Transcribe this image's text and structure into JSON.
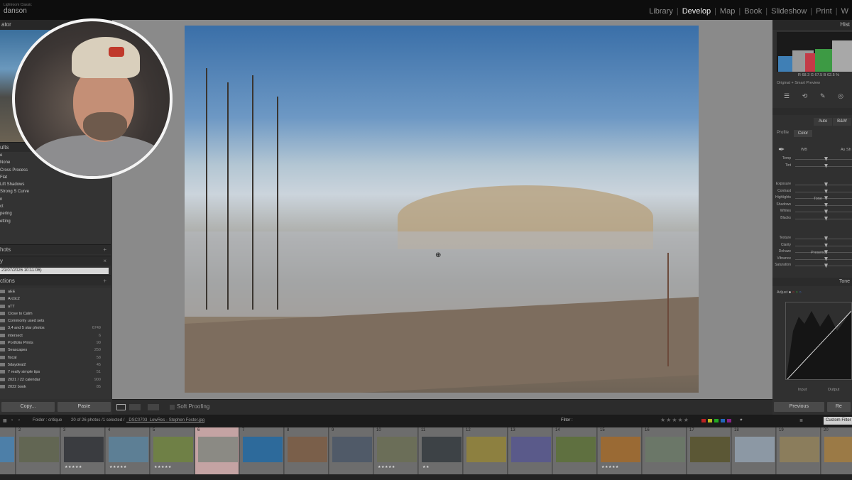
{
  "app": {
    "name": "Lightroom Classic",
    "user": "danson"
  },
  "modules": [
    "Library",
    "Develop",
    "Map",
    "Book",
    "Slideshow",
    "Print",
    "W"
  ],
  "active_module": "Develop",
  "left_panel": {
    "navigator_label": "ator",
    "presets_header": "ults",
    "presets": [
      "e",
      "None",
      "Cross Process",
      "Flat",
      "Lift Shadows",
      "Strong S Curve",
      "n",
      "ct",
      "pering",
      "etting"
    ],
    "snapshots_label": "hots",
    "history_label": "y",
    "history_entry": "21/07/2026 10:11:06)",
    "collections_label": "ctions",
    "collections": [
      {
        "name": "aEE",
        "count": ""
      },
      {
        "name": "Arctic2",
        "count": ""
      },
      {
        "name": "aTT",
        "count": ""
      },
      {
        "name": "Close to Calm",
        "count": ""
      },
      {
        "name": "Commonly used sets",
        "count": ""
      },
      {
        "name": "3,4 and 5 star photos",
        "count": "6749"
      },
      {
        "name": "intersect",
        "count": "6"
      },
      {
        "name": "Portfolio Prints",
        "count": "90"
      },
      {
        "name": "Seascapes",
        "count": "250"
      },
      {
        "name": "fiscal",
        "count": "58"
      },
      {
        "name": "5daydeal2",
        "count": "45"
      },
      {
        "name": "7 really simple tips",
        "count": "51"
      },
      {
        "name": "2021 / 22 calendar",
        "count": "900"
      },
      {
        "name": "2022 book",
        "count": "85"
      }
    ],
    "copy_button": "Copy...",
    "paste_button": "Paste"
  },
  "toolbar": {
    "soft_proofing_label": "Soft Proofing"
  },
  "right_panel": {
    "histogram_label": "Hist",
    "rgb_readout": "R  68.3  G  67.5  B  62.5 %",
    "preview_note": "Original + Smart Preview",
    "treatment": [
      "Auto",
      "B&W"
    ],
    "profile_label": "Profile",
    "profile_value": "Color",
    "wb_label": "WB",
    "wb_value": "As Sh",
    "sliders_wb": [
      "Temp",
      "Tint"
    ],
    "tone_title": "Tone",
    "sliders_tone": [
      "Exposure",
      "Contrast",
      "Highlights",
      "Shadows",
      "Whites",
      "Blacks"
    ],
    "presence_title": "Presence",
    "sliders_presence": [
      "Texture",
      "Clarity",
      "Dehaze",
      "Vibrance",
      "Saturation"
    ],
    "tone_curve_label": "Tone",
    "adjust_label": "Adjust",
    "input_label": "Input",
    "output_label": "Output",
    "previous_button": "Previous",
    "reset_button": "Re"
  },
  "film_bar": {
    "folder_info": "Folder : critique",
    "photo_count": "20 of 26 photos /1 selected /",
    "file_name": "_DSC0703_LowRes - Stephen Foster.jpg",
    "filter_label": "Filter :",
    "stars": "★★★★★",
    "custom_filter": "Custom Filter"
  },
  "filmstrip": [
    {
      "idx": "",
      "rating": "",
      "color": "#4d7fa8"
    },
    {
      "idx": "2",
      "rating": "",
      "color": "#626653"
    },
    {
      "idx": "3",
      "rating": "★★★★★",
      "color": "#3a3c40"
    },
    {
      "idx": "4",
      "rating": "★★★★★",
      "color": "#5d7f95"
    },
    {
      "idx": "5",
      "rating": "★★★★★",
      "color": "#6f8046"
    },
    {
      "idx": "6",
      "rating": "",
      "color": "#8b8a84"
    },
    {
      "idx": "7",
      "rating": "",
      "color": "#2d6a9b"
    },
    {
      "idx": "8",
      "rating": "",
      "color": "#7a5f4a"
    },
    {
      "idx": "9",
      "rating": "",
      "color": "#505a68"
    },
    {
      "idx": "10",
      "rating": "★★★★★",
      "color": "#6b6e58"
    },
    {
      "idx": "11",
      "rating": "★★",
      "color": "#3d4246"
    },
    {
      "idx": "12",
      "rating": "",
      "color": "#8d8040"
    },
    {
      "idx": "13",
      "rating": "",
      "color": "#5a5a8a"
    },
    {
      "idx": "14",
      "rating": "",
      "color": "#5f7040"
    },
    {
      "idx": "15",
      "rating": "★★★★★",
      "color": "#9a6a34"
    },
    {
      "idx": "16",
      "rating": "",
      "color": "#6b7768"
    },
    {
      "idx": "17",
      "rating": "",
      "color": "#5b5735"
    },
    {
      "idx": "18",
      "rating": "",
      "color": "#8c98a4"
    },
    {
      "idx": "19",
      "rating": "",
      "color": "#8b7d5c"
    },
    {
      "idx": "20",
      "rating": "",
      "color": "#9b7a46"
    }
  ]
}
